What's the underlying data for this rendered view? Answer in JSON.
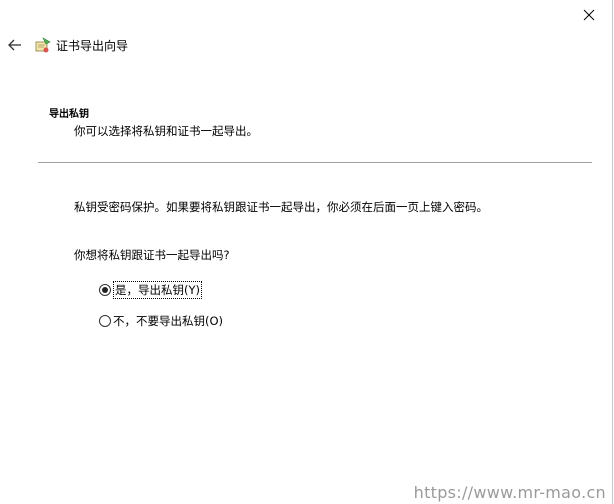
{
  "window": {
    "title": "证书导出向导"
  },
  "header": {
    "title": "导出私钥",
    "subtitle": "你可以选择将私钥和证书一起导出。"
  },
  "content": {
    "info": "私钥受密码保护。如果要将私钥跟证书一起导出，你必须在后面一页上键入密码。",
    "question": "你想将私钥跟证书一起导出吗?",
    "options": [
      {
        "label": "是，导出私钥(Y)",
        "selected": true
      },
      {
        "label": "不，不要导出私钥(O)",
        "selected": false
      }
    ]
  },
  "watermark": "https://www.mr-mao.cn"
}
